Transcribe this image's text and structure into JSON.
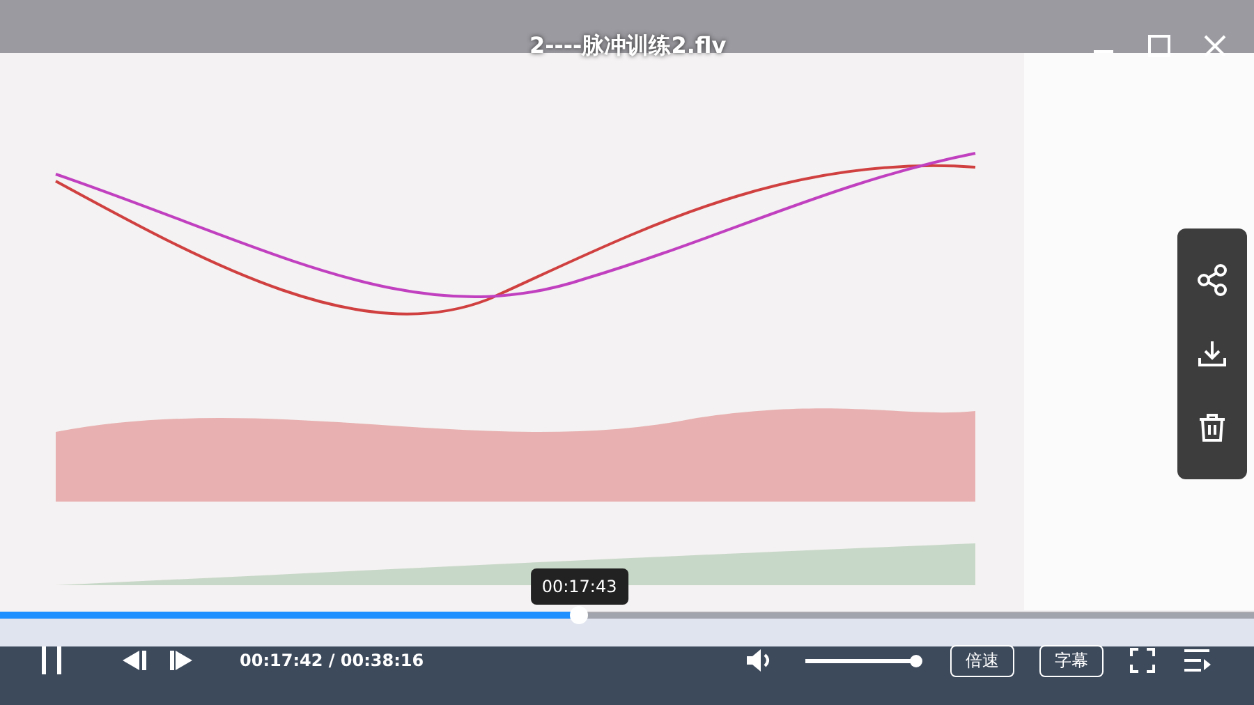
{
  "player": {
    "title": "2----脉冲训练2.flv",
    "window_buttons": [
      {
        "kind": "minimize"
      },
      {
        "kind": "maximize"
      },
      {
        "kind": "close"
      }
    ],
    "side_actions": [
      {
        "kind": "share"
      },
      {
        "kind": "download"
      },
      {
        "kind": "delete"
      }
    ],
    "progress": {
      "level": 0.462,
      "tooltip": "00:17:43"
    },
    "controls": {
      "time": "00:17:42 / 00:38:16",
      "volume": {
        "level": 1
      },
      "speed": "倍速",
      "subtitles": "字幕"
    }
  }
}
